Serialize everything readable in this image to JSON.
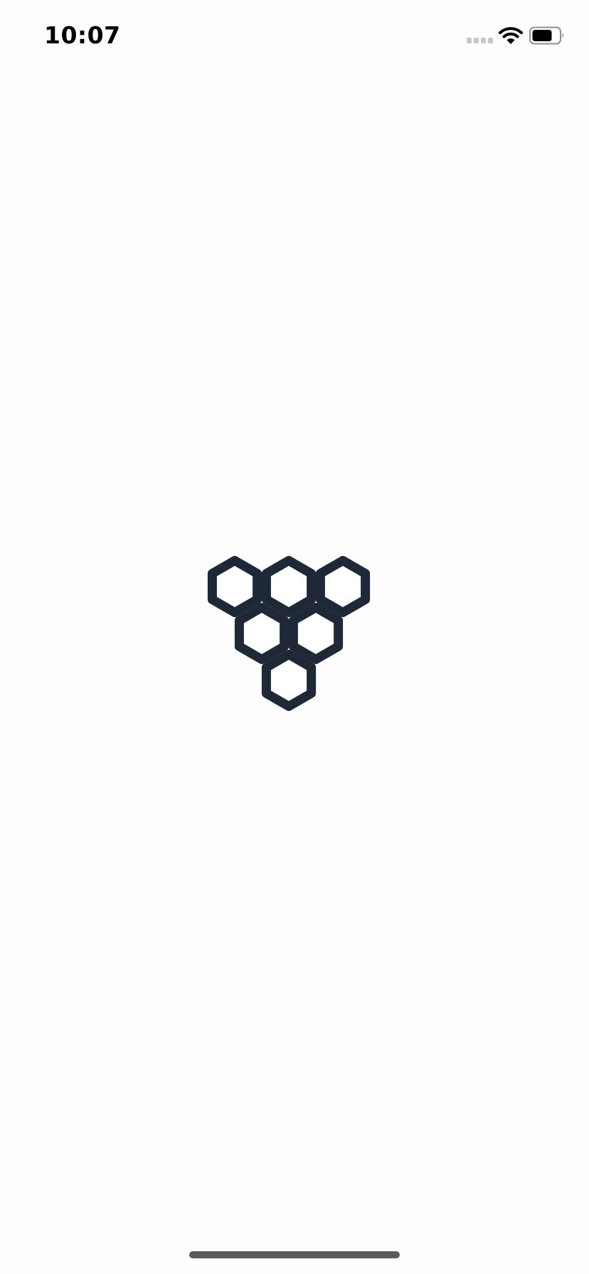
{
  "status_bar": {
    "time": "10:07",
    "signal_icon": "cellular-signal-icon",
    "wifi_icon": "wifi-icon",
    "battery_icon": "battery-icon",
    "battery_level": 0.75
  },
  "splash": {
    "logo_icon": "honeycomb-logo-icon",
    "logo_color": "#1f2836"
  },
  "home_indicator": {
    "color": "#5b5b5b"
  }
}
